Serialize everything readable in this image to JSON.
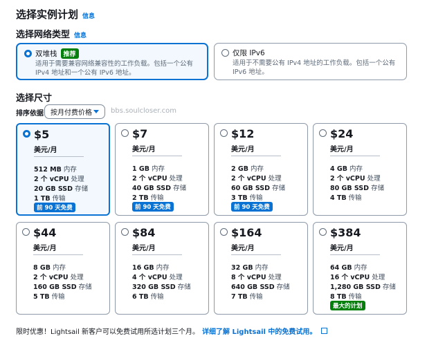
{
  "header": {
    "title": "选择实例计划",
    "info": "信息"
  },
  "network": {
    "title": "选择网络类型",
    "info": "信息",
    "options": [
      {
        "label": "双堆栈",
        "badge": "推荐",
        "desc": "适用于需要兼容网络兼容性的工作负载。包括一个公有 IPv4 地址和一个公有 IPv6 地址。"
      },
      {
        "label": "仅限 IPv6",
        "desc": "适用于不需要公有 IPv4 地址的工作负载。包括一个公有 IPv6 地址。"
      }
    ]
  },
  "size": {
    "title": "选择尺寸",
    "sort_label": "排序依据",
    "sort_value": "按月付费价格",
    "watermark": "bbs.soulcloser.com"
  },
  "plans": [
    {
      "price": "$5",
      "unit": "美元/月",
      "mem": "512 MB",
      "mem_l": "内存",
      "cpu": "2 个 vCPU",
      "cpu_l": "处理",
      "ssd": "20 GB SSD",
      "ssd_l": "存储",
      "tx": "1 TB",
      "tx_l": "传输",
      "tag": "前 90 天免费"
    },
    {
      "price": "$7",
      "unit": "美元/月",
      "mem": "1 GB",
      "mem_l": "内存",
      "cpu": "2 个 vCPU",
      "cpu_l": "处理",
      "ssd": "40 GB SSD",
      "ssd_l": "存储",
      "tx": "2 TB",
      "tx_l": "传输",
      "tag": "前 90 天免费"
    },
    {
      "price": "$12",
      "unit": "美元/月",
      "mem": "2 GB",
      "mem_l": "内存",
      "cpu": "2 个 vCPU",
      "cpu_l": "处理",
      "ssd": "60 GB SSD",
      "ssd_l": "存储",
      "tx": "3 TB",
      "tx_l": "传输",
      "tag": "前 90 天免费"
    },
    {
      "price": "$24",
      "unit": "美元/月",
      "mem": "4 GB",
      "mem_l": "内存",
      "cpu": "2 个 vCPU",
      "cpu_l": "处理",
      "ssd": "80 GB SSD",
      "ssd_l": "存储",
      "tx": "4 TB",
      "tx_l": "传输"
    },
    {
      "price": "$44",
      "unit": "美元/月",
      "mem": "8 GB",
      "mem_l": "内存",
      "cpu": "2 个 vCPU",
      "cpu_l": "处理",
      "ssd": "160 GB SSD",
      "ssd_l": "存储",
      "tx": "5 TB",
      "tx_l": "传输"
    },
    {
      "price": "$84",
      "unit": "美元/月",
      "mem": "16 GB",
      "mem_l": "内存",
      "cpu": "4 个 vCPU",
      "cpu_l": "处理",
      "ssd": "320 GB SSD",
      "ssd_l": "存储",
      "tx": "6 TB",
      "tx_l": "传输"
    },
    {
      "price": "$164",
      "unit": "美元/月",
      "mem": "32 GB",
      "mem_l": "内存",
      "cpu": "8 个 vCPU",
      "cpu_l": "处理",
      "ssd": "640 GB SSD",
      "ssd_l": "存储",
      "tx": "7 TB",
      "tx_l": "传输"
    },
    {
      "price": "$384",
      "unit": "美元/月",
      "mem": "64 GB",
      "mem_l": "内存",
      "cpu": "16 个 vCPU",
      "cpu_l": "处理",
      "ssd": "1,280 GB SSD",
      "ssd_l": "存储",
      "tx": "8 TB",
      "tx_l": "传输",
      "tag": "最大的计划"
    }
  ],
  "footer": {
    "text": "限时优惠！Lightsail 新客户可以免费试用所选计划三个月。",
    "link": "详细了解 Lightsail 中的免费试用。"
  },
  "colors": {
    "accent": "#0972d3",
    "green": "#037f0c"
  }
}
